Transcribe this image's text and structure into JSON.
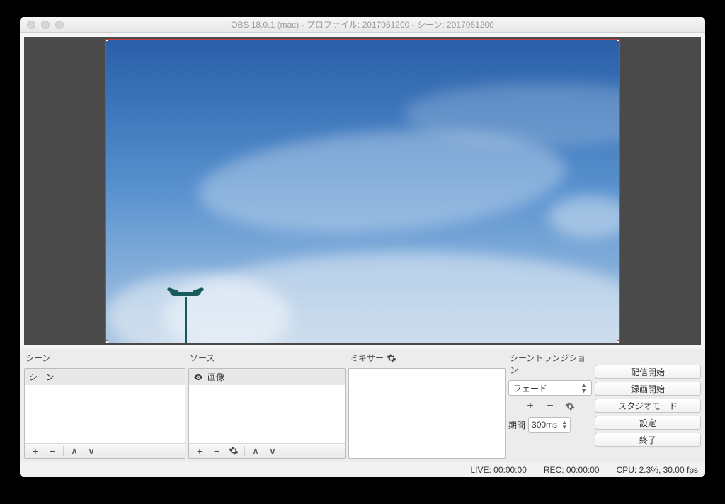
{
  "window": {
    "title": "OBS 18.0.1 (mac) - プロファイル: 2017051200 - シーン: 2017051200"
  },
  "panels": {
    "scenes_label": "シーン",
    "sources_label": "ソース",
    "mixer_label": "ミキサー",
    "transition_label": "シーントランジション"
  },
  "scenes": {
    "items": [
      {
        "label": "シーン"
      }
    ]
  },
  "sources": {
    "items": [
      {
        "label": "画像"
      }
    ]
  },
  "transition": {
    "selected": "フェード",
    "duration_label": "期間",
    "duration_value": "300ms"
  },
  "controls": {
    "start_streaming": "配信開始",
    "start_recording": "録画開始",
    "studio_mode": "スタジオモード",
    "settings": "設定",
    "exit": "終了"
  },
  "icons": {
    "plus": "+",
    "minus": "−",
    "up": "∧",
    "down": "∨"
  },
  "status": {
    "live": "LIVE: 00:00:00",
    "rec": "REC: 00:00:00",
    "cpu": "CPU: 2.3%, 30.00 fps"
  }
}
